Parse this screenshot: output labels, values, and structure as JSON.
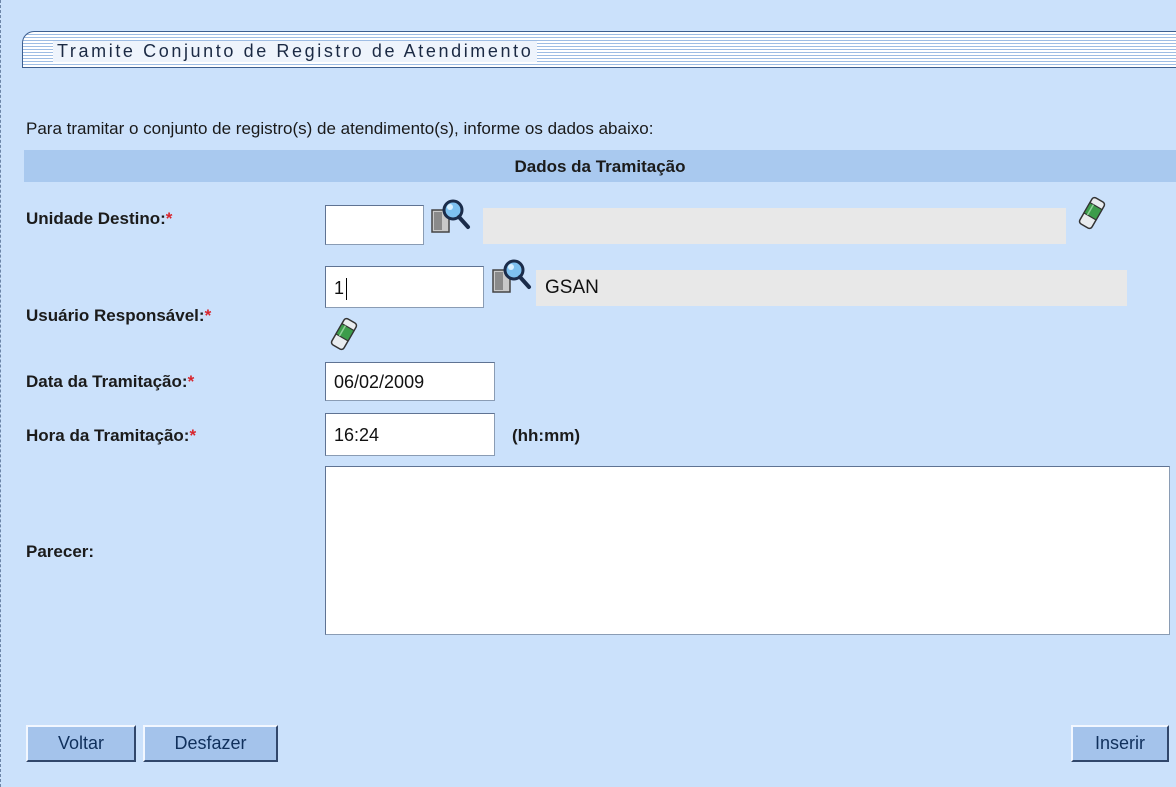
{
  "title": "Tramite Conjunto de Registro de Atendimento",
  "intro": "Para tramitar o conjunto de registro(s) de atendimento(s), informe os dados abaixo:",
  "section_header": "Dados da Tramitação",
  "required_marker": "*",
  "fields": {
    "unidade_destino": {
      "label": "Unidade Destino:",
      "code_value": "",
      "description_value": "",
      "search_icon": "magnifier-search-icon",
      "clear_icon": "eraser-icon"
    },
    "usuario_responsavel": {
      "label": "Usuário Responsável:",
      "code_value": "1",
      "description_value": "GSAN",
      "search_icon": "magnifier-search-icon",
      "clear_icon": "eraser-icon"
    },
    "data_tramitacao": {
      "label": "Data da Tramitação:",
      "value": "06/02/2009"
    },
    "hora_tramitacao": {
      "label": "Hora da Tramitação:",
      "value": "16:24",
      "hint": "(hh:mm)"
    },
    "parecer": {
      "label": "Parecer:",
      "value": ""
    }
  },
  "buttons": {
    "voltar": "Voltar",
    "desfazer": "Desfazer",
    "inserir": "Inserir"
  },
  "colors": {
    "background": "#cbe1fb",
    "header_band": "#a9c9ef",
    "button": "#a4c3eb",
    "required": "#d8242c"
  }
}
